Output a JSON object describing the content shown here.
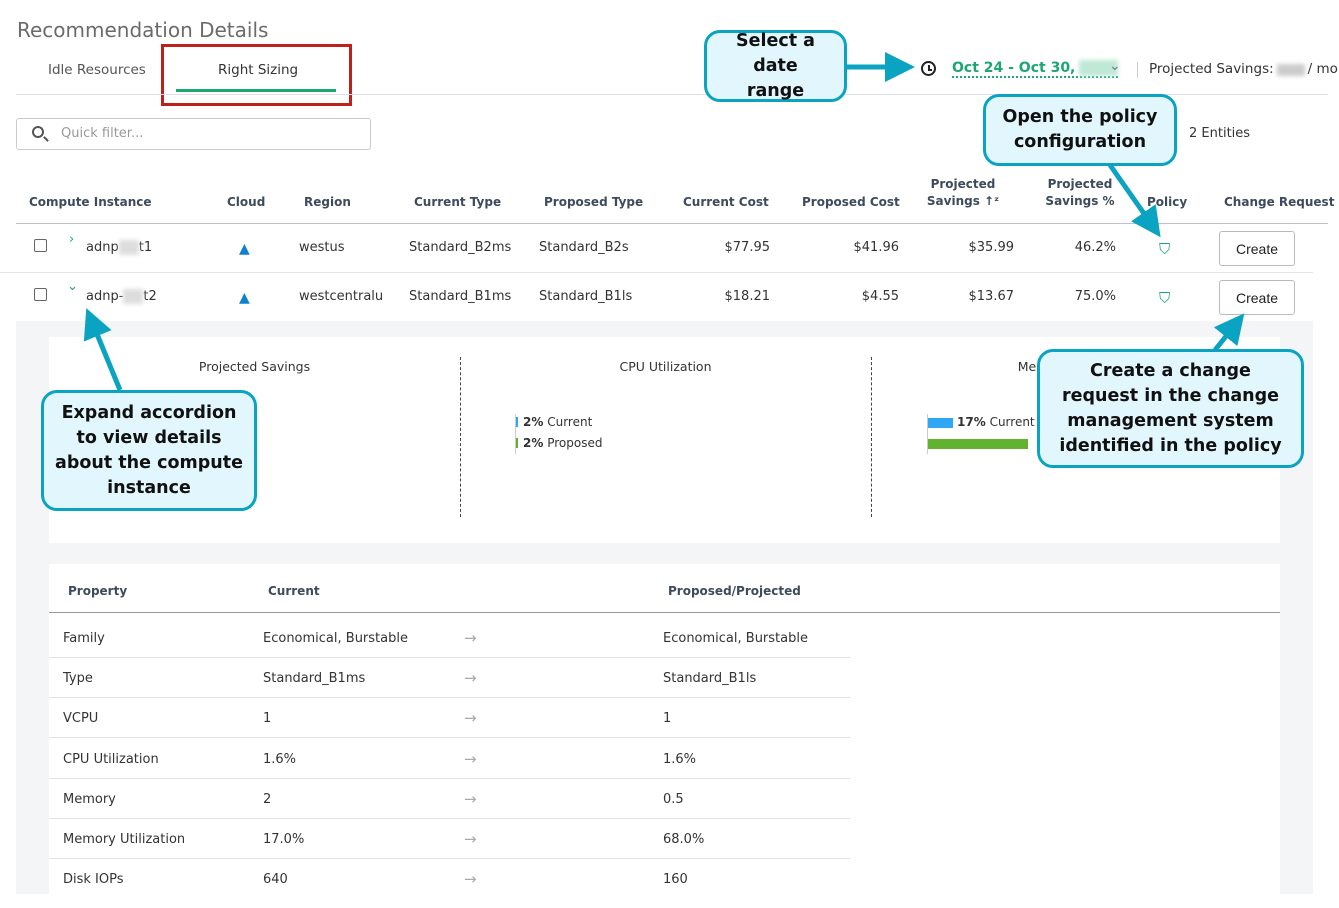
{
  "page_title": "Recommendation Details",
  "tabs": [
    {
      "label": "Idle Resources",
      "active": false
    },
    {
      "label": "Right Sizing",
      "active": true
    }
  ],
  "date_range": {
    "label": "Oct 24 - Oct 30,",
    "year_blurred": "2021"
  },
  "projected_savings": {
    "label": "Projected Savings:",
    "suffix": "/ mo"
  },
  "search": {
    "placeholder": "Quick filter..."
  },
  "entities": "2 Entities",
  "columns": [
    "Compute Instance",
    "Cloud",
    "Region",
    "Current Type",
    "Proposed Type",
    "Current Cost",
    "Proposed Cost",
    "Projected Savings",
    "Projected Savings %",
    "Policy",
    "Change Request"
  ],
  "rows": [
    {
      "name_prefix": "adnp",
      "name_suffix": "t1",
      "region": "westus",
      "current_type": "Standard_B2ms",
      "proposed_type": "Standard_B2s",
      "current_cost": "$77.95",
      "proposed_cost": "$41.96",
      "savings": "$35.99",
      "savings_pct": "46.2%",
      "button": "Create",
      "expanded": false
    },
    {
      "name_prefix": "adnp-",
      "name_suffix": "t2",
      "region": "westcentralu",
      "current_type": "Standard_B1ms",
      "proposed_type": "Standard_B1ls",
      "current_cost": "$18.21",
      "proposed_cost": "$4.55",
      "savings": "$13.67",
      "savings_pct": "75.0%",
      "button": "Create",
      "expanded": true
    }
  ],
  "details": {
    "sections": [
      "Projected Savings",
      "CPU Utilization",
      "Memory Utilization"
    ],
    "cpu": {
      "current_value": "2%",
      "current_label": "Current",
      "current_pct": 2,
      "proposed_value": "2%",
      "proposed_label": "Proposed",
      "proposed_pct": 2
    },
    "memory": {
      "current_value": "17%",
      "current_label": "Current",
      "current_pct": 17,
      "proposed_pct": 68
    },
    "colors": {
      "current": "#2ea8f5",
      "proposed": "#62b22f"
    },
    "table_headers": [
      "Property",
      "Current",
      "Proposed/Projected"
    ],
    "properties": [
      {
        "property": "Family",
        "current": "Economical, Burstable",
        "proposed": "Economical, Burstable"
      },
      {
        "property": "Type",
        "current": "Standard_B1ms",
        "proposed": "Standard_B1ls"
      },
      {
        "property": "VCPU",
        "current": "1",
        "proposed": "1"
      },
      {
        "property": "CPU Utilization",
        "current": "1.6%",
        "proposed": "1.6%"
      },
      {
        "property": "Memory",
        "current": "2",
        "proposed": "0.5"
      },
      {
        "property": "Memory Utilization",
        "current": "17.0%",
        "proposed": "68.0%"
      },
      {
        "property": "Disk IOPs",
        "current": "640",
        "proposed": "160"
      }
    ]
  },
  "callouts": {
    "date": "Select a date range",
    "policy": "Open the policy configuration",
    "create": "Create a change request in the change management system identified in the policy",
    "expand": "Expand accordion to view details about the compute instance"
  },
  "colors": {
    "accent": "#1ba672",
    "callout_border": "#0aa3c2",
    "highlight": "#c0201a"
  }
}
